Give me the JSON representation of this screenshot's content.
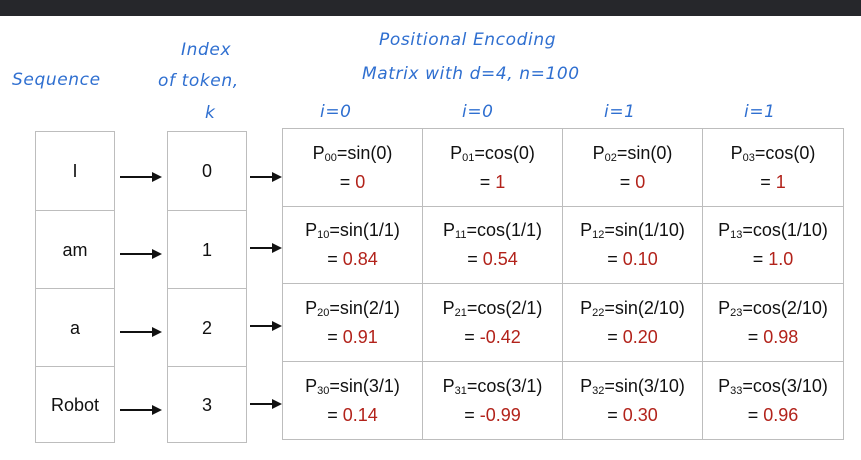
{
  "labels": {
    "sequence": "Sequence",
    "index_line1": "Index",
    "index_line2": "of token,",
    "index_line3": "k",
    "pe_line1": "Positional Encoding",
    "pe_line2": "Matrix with d=4, n=100"
  },
  "column_headers": [
    "i=0",
    "i=0",
    "i=1",
    "i=1"
  ],
  "tokens": [
    "I",
    "am",
    "a",
    "Robot"
  ],
  "indices": [
    "0",
    "1",
    "2",
    "3"
  ],
  "matrix": [
    [
      {
        "sub": "00",
        "expr": "=sin(0)",
        "value": "0"
      },
      {
        "sub": "01",
        "expr": "=cos(0)",
        "value": "1"
      },
      {
        "sub": "02",
        "expr": "=sin(0)",
        "value": "0"
      },
      {
        "sub": "03",
        "expr": "=cos(0)",
        "value": "1"
      }
    ],
    [
      {
        "sub": "10",
        "expr": "=sin(1/1)",
        "value": "0.84"
      },
      {
        "sub": "11",
        "expr": "=cos(1/1)",
        "value": "0.54"
      },
      {
        "sub": "12",
        "expr": "=sin(1/10)",
        "value": "0.10"
      },
      {
        "sub": "13",
        "expr": "=cos(1/10)",
        "value": "1.0"
      }
    ],
    [
      {
        "sub": "20",
        "expr": "=sin(2/1)",
        "value": "0.91"
      },
      {
        "sub": "21",
        "expr": "=cos(2/1)",
        "value": "-0.42"
      },
      {
        "sub": "22",
        "expr": "=sin(2/10)",
        "value": "0.20"
      },
      {
        "sub": "23",
        "expr": "=cos(2/10)",
        "value": "0.98"
      }
    ],
    [
      {
        "sub": "30",
        "expr": "=sin(3/1)",
        "value": "0.14"
      },
      {
        "sub": "31",
        "expr": "=cos(3/1)",
        "value": "-0.99"
      },
      {
        "sub": "32",
        "expr": "=sin(3/10)",
        "value": "0.30"
      },
      {
        "sub": "33",
        "expr": "=cos(3/10)",
        "value": "0.96"
      }
    ]
  ],
  "colors": {
    "handwriting": "#2f6fd0",
    "value": "#b2221a",
    "border": "#bdbdbd"
  }
}
